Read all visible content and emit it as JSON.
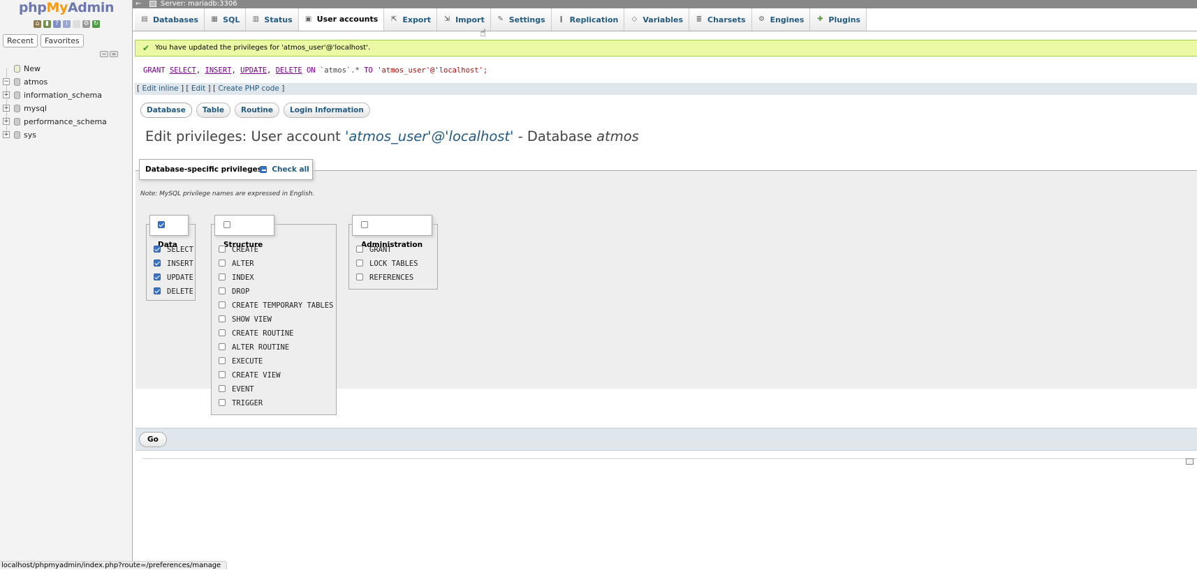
{
  "sidebar": {
    "logo_php": "php",
    "logo_my": "My",
    "logo_admin": "Admin",
    "tabs": [
      "Recent",
      "Favorites"
    ],
    "tree": [
      {
        "label": "New"
      },
      {
        "label": "atmos"
      },
      {
        "label": "information_schema"
      },
      {
        "label": "mysql"
      },
      {
        "label": "performance_schema"
      },
      {
        "label": "sys"
      }
    ]
  },
  "serverbar": {
    "back": "←",
    "text": "Server: mariadb:3306"
  },
  "topmenu": {
    "tabs": [
      {
        "label": "Databases",
        "icon": "databases-icon"
      },
      {
        "label": "SQL",
        "icon": "sql-icon"
      },
      {
        "label": "Status",
        "icon": "status-icon"
      },
      {
        "label": "User accounts",
        "icon": "user-accounts-icon",
        "active": true
      },
      {
        "label": "Export",
        "icon": "export-icon"
      },
      {
        "label": "Import",
        "icon": "import-icon"
      },
      {
        "label": "Settings",
        "icon": "wrench-icon"
      },
      {
        "label": "Replication",
        "icon": "replication-icon"
      },
      {
        "label": "Variables",
        "icon": "variables-icon"
      },
      {
        "label": "Charsets",
        "icon": "charsets-icon"
      },
      {
        "label": "Engines",
        "icon": "engines-icon"
      },
      {
        "label": "Plugins",
        "icon": "plugins-icon"
      }
    ]
  },
  "message": {
    "success": "You have updated the privileges for 'atmos_user'@'localhost'."
  },
  "sql": {
    "grant": "GRANT",
    "privs": [
      "SELECT",
      "INSERT",
      "UPDATE",
      "DELETE"
    ],
    "on": "ON",
    "table": "`atmos`.*",
    "to": "TO",
    "user": "'atmos_user'@'localhost';"
  },
  "edit_bar": {
    "edit_inline": "Edit inline",
    "edit": "Edit",
    "create_php": "Create PHP code"
  },
  "subtabs": [
    "Database",
    "Table",
    "Routine",
    "Login Information"
  ],
  "title": {
    "prefix": "Edit privileges: User account ",
    "account": "'atmos_user'@'localhost'",
    "middle": " - Database ",
    "database": "atmos"
  },
  "privileges": {
    "legend": "Database-specific privileges",
    "check_all": "Check all",
    "note": "Note: MySQL privilege names are expressed in English.",
    "groups": {
      "data": {
        "label": "Data",
        "checked": true,
        "items": [
          {
            "name": "SELECT",
            "checked": true
          },
          {
            "name": "INSERT",
            "checked": true
          },
          {
            "name": "UPDATE",
            "checked": true
          },
          {
            "name": "DELETE",
            "checked": true
          }
        ]
      },
      "structure": {
        "label": "Structure",
        "checked": false,
        "items": [
          {
            "name": "CREATE",
            "checked": false
          },
          {
            "name": "ALTER",
            "checked": false
          },
          {
            "name": "INDEX",
            "checked": false
          },
          {
            "name": "DROP",
            "checked": false
          },
          {
            "name": "CREATE TEMPORARY TABLES",
            "checked": false
          },
          {
            "name": "SHOW VIEW",
            "checked": false
          },
          {
            "name": "CREATE ROUTINE",
            "checked": false
          },
          {
            "name": "ALTER ROUTINE",
            "checked": false
          },
          {
            "name": "EXECUTE",
            "checked": false
          },
          {
            "name": "CREATE VIEW",
            "checked": false
          },
          {
            "name": "EVENT",
            "checked": false
          },
          {
            "name": "TRIGGER",
            "checked": false
          }
        ]
      },
      "administration": {
        "label": "Administration",
        "checked": false,
        "items": [
          {
            "name": "GRANT",
            "checked": false
          },
          {
            "name": "LOCK TABLES",
            "checked": false
          },
          {
            "name": "REFERENCES",
            "checked": false
          }
        ]
      }
    }
  },
  "go_button": "Go",
  "status_url": "localhost/phpmyadmin/index.php?route=/preferences/manage"
}
